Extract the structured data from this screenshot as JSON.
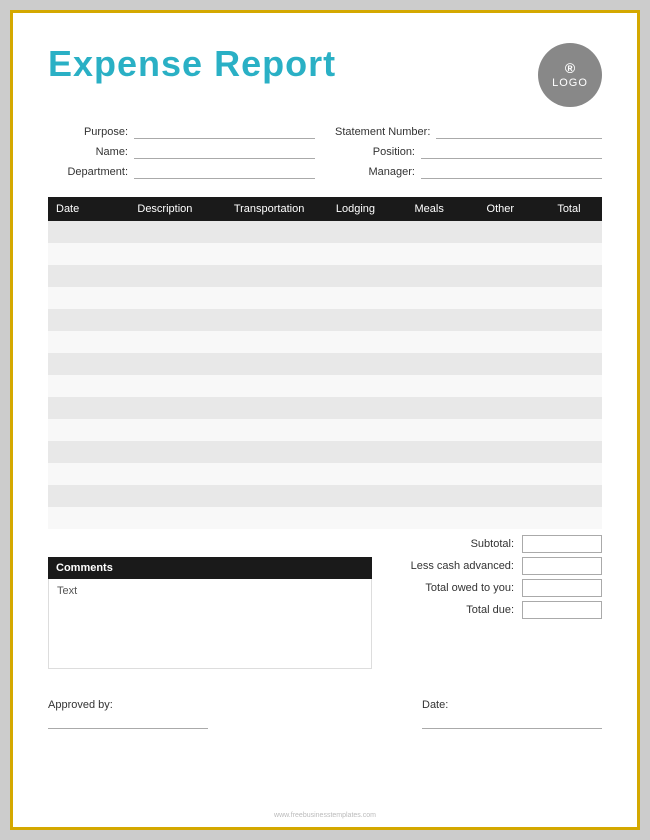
{
  "header": {
    "title": "Expense Report",
    "logo_registered": "®",
    "logo_text": "LOGO"
  },
  "info_fields": {
    "left": [
      {
        "label": "Purpose:",
        "id": "purpose"
      },
      {
        "label": "Name:",
        "id": "name"
      },
      {
        "label": "Department:",
        "id": "department"
      }
    ],
    "right": [
      {
        "label": "Statement Number:",
        "id": "statement-number"
      },
      {
        "label": "Position:",
        "id": "position"
      },
      {
        "label": "Manager:",
        "id": "manager"
      }
    ]
  },
  "table": {
    "columns": [
      "Date",
      "Description",
      "Transportation",
      "Lodging",
      "Meals",
      "Other",
      "Total"
    ],
    "rows": 14
  },
  "summary": {
    "subtotal_label": "Subtotal:",
    "less_cash_label": "Less cash advanced:",
    "total_owed_label": "Total owed to you:",
    "total_due_label": "Total due:"
  },
  "comments": {
    "header": "Comments",
    "body_text": "Text"
  },
  "approval": {
    "approved_by_label": "Approved by:",
    "date_label": "Date:"
  },
  "watermark": "www.freebusinesstemplates.com"
}
